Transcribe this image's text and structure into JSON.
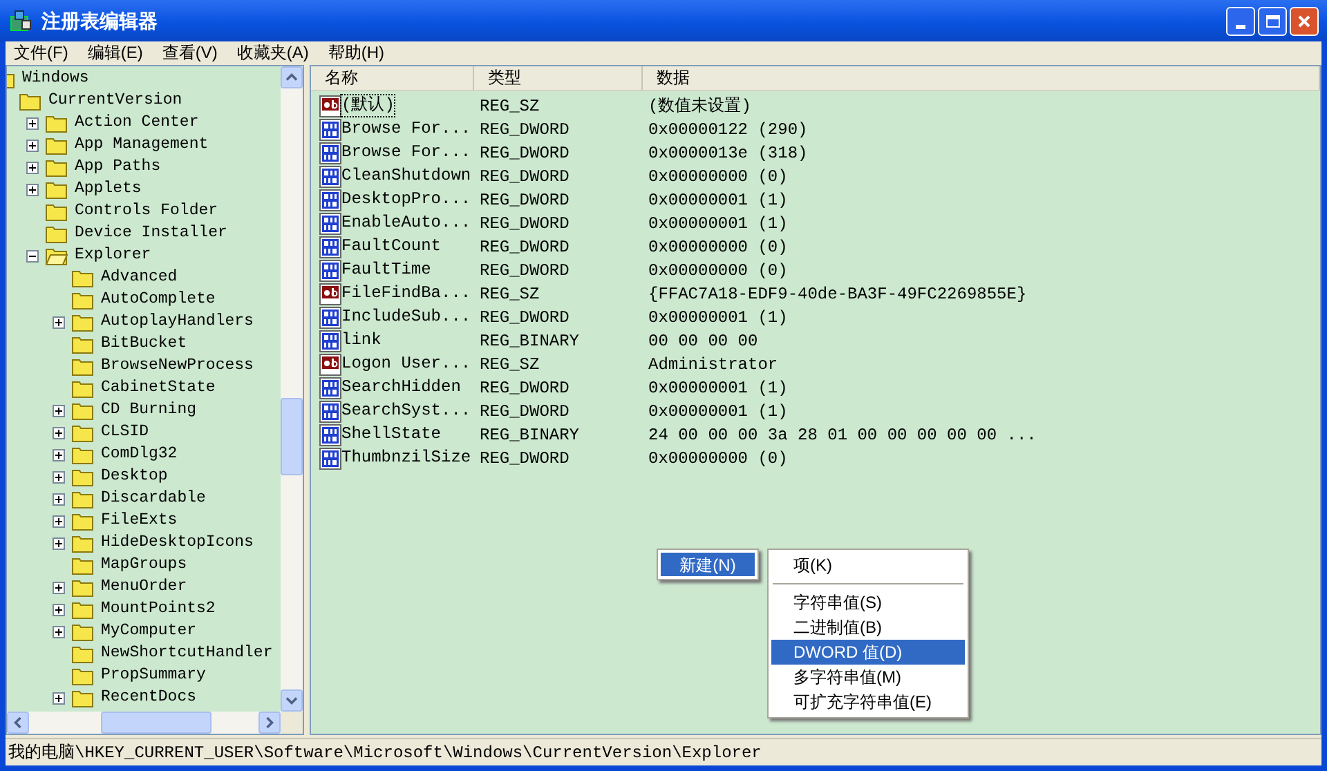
{
  "window": {
    "title": "注册表编辑器"
  },
  "menu": [
    "文件(F)",
    "编辑(E)",
    "查看(V)",
    "收藏夹(A)",
    "帮助(H)"
  ],
  "tree": [
    {
      "label": "Windows",
      "children": [
        {
          "label": "CurrentVersion",
          "children": [
            {
              "label": "Action Center",
              "expanded": false
            },
            {
              "label": "App Management",
              "expanded": false
            },
            {
              "label": "App Paths",
              "expanded": false
            },
            {
              "label": "Applets",
              "expanded": false
            },
            {
              "label": "Controls Folder"
            },
            {
              "label": "Device Installer"
            },
            {
              "label": "Explorer",
              "expanded": true,
              "children": [
                {
                  "label": "Advanced"
                },
                {
                  "label": "AutoComplete"
                },
                {
                  "label": "AutoplayHandlers",
                  "expanded": false
                },
                {
                  "label": "BitBucket"
                },
                {
                  "label": "BrowseNewProcess"
                },
                {
                  "label": "CabinetState"
                },
                {
                  "label": "CD Burning",
                  "expanded": false
                },
                {
                  "label": "CLSID",
                  "expanded": false
                },
                {
                  "label": "ComDlg32",
                  "expanded": false
                },
                {
                  "label": "Desktop",
                  "expanded": false
                },
                {
                  "label": "Discardable",
                  "expanded": false
                },
                {
                  "label": "FileExts",
                  "expanded": false
                },
                {
                  "label": "HideDesktopIcons",
                  "expanded": false
                },
                {
                  "label": "MapGroups"
                },
                {
                  "label": "MenuOrder",
                  "expanded": false
                },
                {
                  "label": "MountPoints2",
                  "expanded": false
                },
                {
                  "label": "MyComputer",
                  "expanded": false
                },
                {
                  "label": "NewShortcutHandler"
                },
                {
                  "label": "PropSummary"
                },
                {
                  "label": "RecentDocs",
                  "expanded": false
                }
              ]
            }
          ]
        }
      ]
    }
  ],
  "list": {
    "columns": [
      "名称",
      "类型",
      "数据"
    ],
    "rows": [
      {
        "kind": "string",
        "name": "(默认)",
        "type": "REG_SZ",
        "data": "(数值未设置)",
        "focused": true
      },
      {
        "kind": "binary",
        "name": "Browse For...",
        "type": "REG_DWORD",
        "data": "0x00000122 (290)",
        "focused": false
      },
      {
        "kind": "binary",
        "name": "Browse For...",
        "type": "REG_DWORD",
        "data": "0x0000013e (318)",
        "focused": false
      },
      {
        "kind": "binary",
        "name": "CleanShutdown",
        "type": "REG_DWORD",
        "data": "0x00000000 (0)",
        "focused": false
      },
      {
        "kind": "binary",
        "name": "DesktopPro...",
        "type": "REG_DWORD",
        "data": "0x00000001 (1)",
        "focused": false
      },
      {
        "kind": "binary",
        "name": "EnableAuto...",
        "type": "REG_DWORD",
        "data": "0x00000001 (1)",
        "focused": false
      },
      {
        "kind": "binary",
        "name": "FaultCount",
        "type": "REG_DWORD",
        "data": "0x00000000 (0)",
        "focused": false
      },
      {
        "kind": "binary",
        "name": "FaultTime",
        "type": "REG_DWORD",
        "data": "0x00000000 (0)",
        "focused": false
      },
      {
        "kind": "string",
        "name": "FileFindBa...",
        "type": "REG_SZ",
        "data": "{FFAC7A18-EDF9-40de-BA3F-49FC2269855E}",
        "focused": false
      },
      {
        "kind": "binary",
        "name": "IncludeSub...",
        "type": "REG_DWORD",
        "data": "0x00000001 (1)",
        "focused": false
      },
      {
        "kind": "binary",
        "name": "link",
        "type": "REG_BINARY",
        "data": "00 00 00 00",
        "focused": false
      },
      {
        "kind": "string",
        "name": "Logon User...",
        "type": "REG_SZ",
        "data": "Administrator",
        "focused": false
      },
      {
        "kind": "binary",
        "name": "SearchHidden",
        "type": "REG_DWORD",
        "data": "0x00000001 (1)",
        "focused": false
      },
      {
        "kind": "binary",
        "name": "SearchSyst...",
        "type": "REG_DWORD",
        "data": "0x00000001 (1)",
        "focused": false
      },
      {
        "kind": "binary",
        "name": "ShellState",
        "type": "REG_BINARY",
        "data": "24 00 00 00 3a 28 01 00 00 00 00 00 ...",
        "focused": false
      },
      {
        "kind": "binary",
        "name": "ThumbnzilSize",
        "type": "REG_DWORD",
        "data": "0x00000000 (0)",
        "focused": false
      }
    ]
  },
  "context_menu": {
    "label": "新建(N)",
    "selected": true,
    "submenu": [
      {
        "kind": "item",
        "label": "项(K)",
        "selected": false
      },
      {
        "kind": "separator"
      },
      {
        "kind": "item",
        "label": "字符串值(S)",
        "selected": false
      },
      {
        "kind": "item",
        "label": "二进制值(B)",
        "selected": false
      },
      {
        "kind": "item",
        "label": "DWORD 值(D)",
        "selected": true
      },
      {
        "kind": "item",
        "label": "多字符串值(M)",
        "selected": false
      },
      {
        "kind": "item",
        "label": "可扩充字符串值(E)",
        "selected": false
      }
    ]
  },
  "status_bar": "我的电脑\\HKEY_CURRENT_USER\\Software\\Microsoft\\Windows\\CurrentVersion\\Explorer"
}
